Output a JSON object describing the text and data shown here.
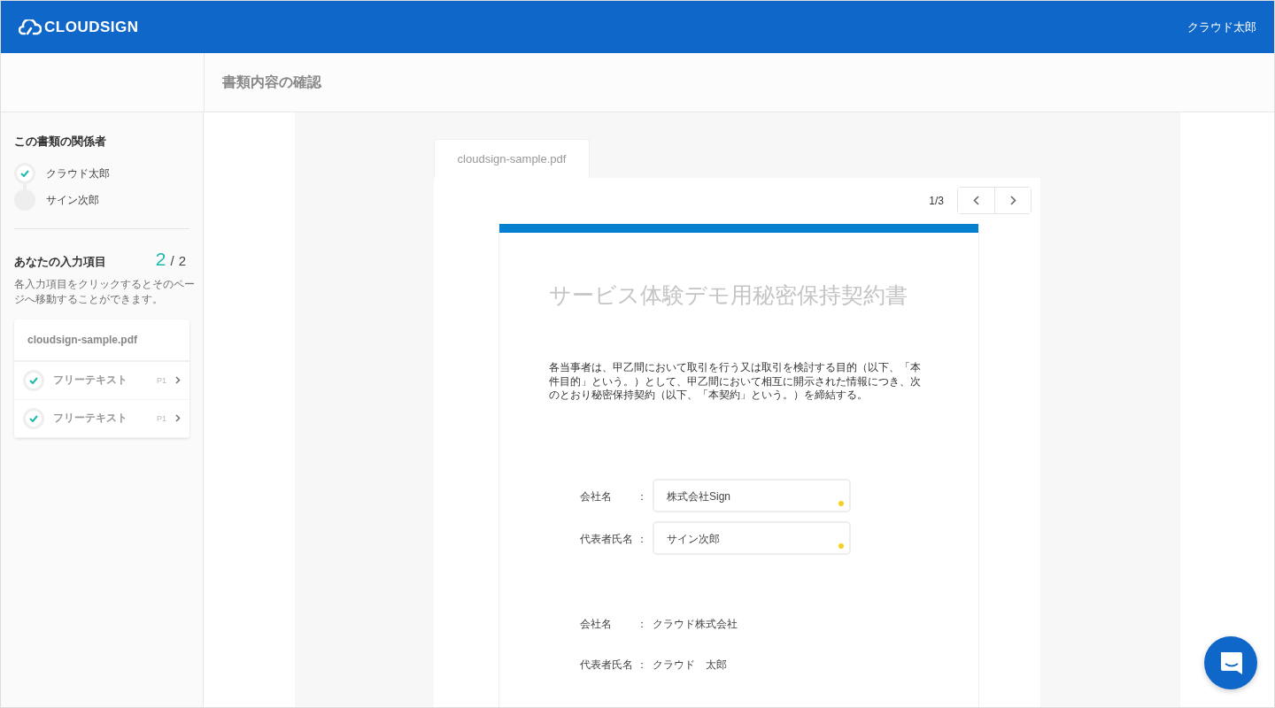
{
  "header": {
    "logo": "CLOUDSIGN",
    "user": "クラウド太郎"
  },
  "page_title": "書類内容の確認",
  "sidebar": {
    "parties_title": "この書類の関係者",
    "parties": [
      {
        "name": "クラウド太郎",
        "done": true
      },
      {
        "name": "サイン次郎",
        "done": false
      }
    ],
    "inputs_title": "あなたの入力項目",
    "progress": {
      "done": "2",
      "slash": "/",
      "total": "2"
    },
    "hint": "各入力項目をクリックするとそのページへ移動することができます。",
    "file_name": "cloudsign-sample.pdf",
    "fields": [
      {
        "label": "フリーテキスト",
        "page": "P1",
        "checked": true
      },
      {
        "label": "フリーテキスト",
        "page": "P1",
        "checked": true
      }
    ]
  },
  "document": {
    "tab": "cloudsign-sample.pdf",
    "pager": "1/3",
    "title": "サービス体験デモ用秘密保持契約書",
    "body": "各当事者は、甲乙間において取引を行う又は取引を検討する目的（以下、「本件目的」という。）として、甲乙間において相互に開示された情報につき、次のとおり秘密保持契約（以下、「本契約」という。）を締結する。",
    "rows": [
      {
        "kind": "input",
        "label": "会社名",
        "colon": "：",
        "value": "株式会社Sign"
      },
      {
        "kind": "input",
        "label": "代表者氏名",
        "colon": "：",
        "value": "サイン次郎"
      },
      {
        "kind": "text",
        "label": "会社名",
        "colon": "：",
        "value": "クラウド株式会社"
      },
      {
        "kind": "text",
        "label": "代表者氏名",
        "colon": "：",
        "value": "クラウド　太郎"
      }
    ]
  }
}
